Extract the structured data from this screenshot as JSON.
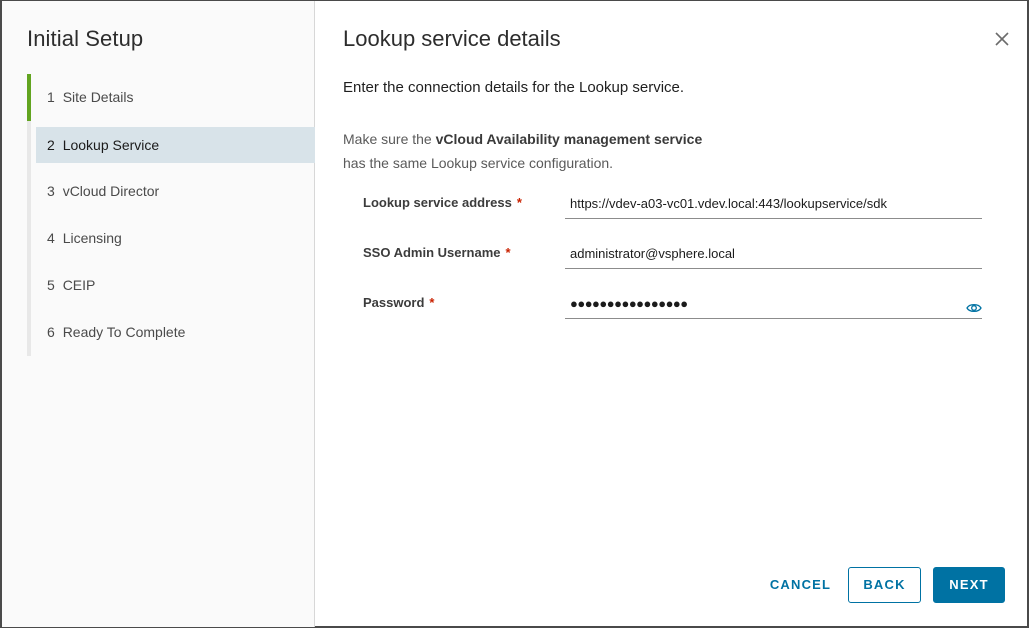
{
  "wizard": {
    "title": "Initial Setup",
    "steps": [
      {
        "num": "1",
        "label": "Site Details",
        "state": "done"
      },
      {
        "num": "2",
        "label": "Lookup Service",
        "state": "active"
      },
      {
        "num": "3",
        "label": "vCloud Director",
        "state": "pending"
      },
      {
        "num": "4",
        "label": "Licensing",
        "state": "pending"
      },
      {
        "num": "5",
        "label": "CEIP",
        "state": "pending"
      },
      {
        "num": "6",
        "label": "Ready To Complete",
        "state": "pending"
      }
    ]
  },
  "page": {
    "title": "Lookup service details",
    "intro": "Enter the connection details for the Lookup service.",
    "note_prefix": "Make sure the ",
    "note_bold": "vCloud Availability management service",
    "note_suffix": "has the same Lookup service configuration."
  },
  "form": {
    "lookup_address": {
      "label": "Lookup service address",
      "required": "*",
      "value": "https://vdev-a03-vc01.vdev.local:443/lookupservice/sdk"
    },
    "sso_username": {
      "label": "SSO Admin Username",
      "required": "*",
      "value": "administrator@vsphere.local"
    },
    "password": {
      "label": "Password",
      "required": "*",
      "value": "●●●●●●●●●●●●●●●●"
    }
  },
  "buttons": {
    "cancel": "CANCEL",
    "back": "BACK",
    "next": "NEXT"
  },
  "colors": {
    "accent": "#0072a3",
    "done_step": "#62a420",
    "active_step_bg": "#d8e3e9",
    "required": "#c92100"
  },
  "icons": {
    "close": "close-icon",
    "eye": "eye-icon"
  }
}
